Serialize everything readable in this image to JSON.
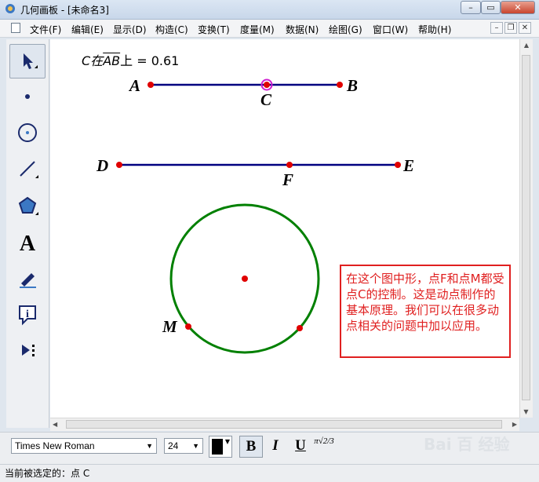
{
  "window": {
    "title": "几何画板 - [未命名3]"
  },
  "menu": [
    "文件(F)",
    "编辑(E)",
    "显示(D)",
    "构造(C)",
    "变换(T)",
    "度量(M)",
    "数据(N)",
    "绘图(G)",
    "窗口(W)",
    "帮助(H)"
  ],
  "measurement": {
    "prefix": "C在",
    "segment": "AB",
    "suffix": "上 = 0.61"
  },
  "points": {
    "A": "A",
    "B": "B",
    "C": "C",
    "D": "D",
    "E": "E",
    "F": "F",
    "M": "M"
  },
  "colors": {
    "segment": "#000080",
    "circle": "#008000",
    "point": "#e00000",
    "note": "#e02020",
    "selected_halo": "#d020d0"
  },
  "note": "在这个图中形，点F和点M都受点C的控制。这是动点制作的基本原理。我们可以在很多动点相关的问题中加以应用。",
  "textbar": {
    "font": "Times New Roman",
    "size": "24",
    "bold": "B",
    "italic": "I",
    "underline": "U",
    "math_symbol": "π√2/3"
  },
  "status": "当前被选定的：点 C",
  "watermark": "Bai 百 经验",
  "tools": [
    "arrow-icon",
    "point-icon",
    "compass-icon",
    "line-icon",
    "polygon-icon",
    "text-icon",
    "marker-icon",
    "info-icon",
    "custom-tool-icon"
  ]
}
